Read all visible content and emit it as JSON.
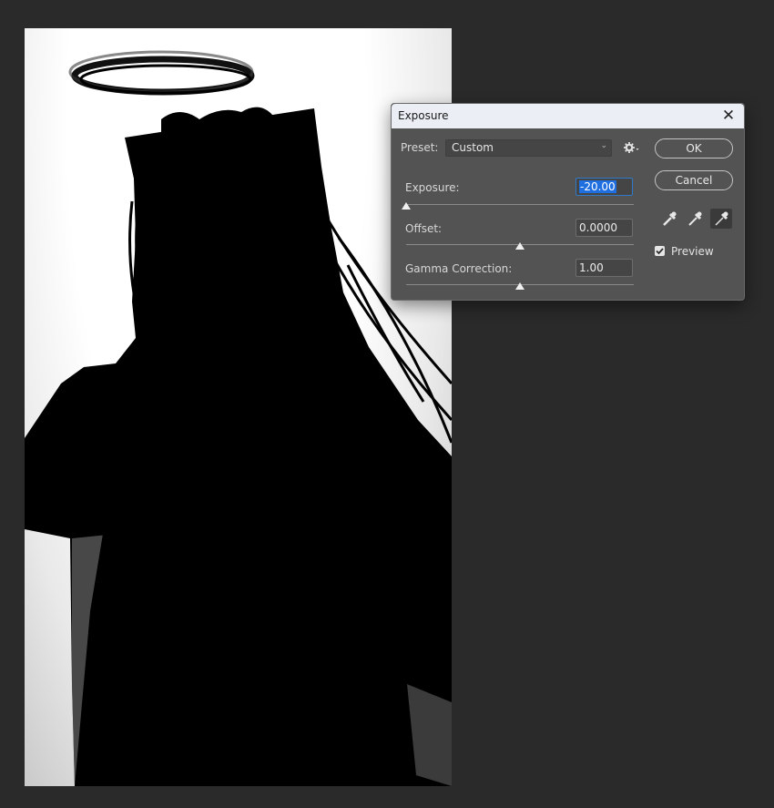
{
  "document": {
    "artwork": "black silhouette of a long-haired figure with a halo on a white-to-gray gradient background"
  },
  "dialog": {
    "title": "Exposure",
    "close_icon": "close-icon",
    "preset": {
      "label": "Preset:",
      "value": "Custom",
      "menu_icon": "gear-icon"
    },
    "sliders": [
      {
        "label": "Exposure:",
        "value": "-20.00",
        "min": -20,
        "max": 20,
        "current": -20
      },
      {
        "label": "Offset:",
        "value": "0.0000",
        "min": -0.5,
        "max": 0.5,
        "current": 0.0
      },
      {
        "label": "Gamma Correction:",
        "value": "1.00",
        "min": 0.01,
        "max": 9.99,
        "current": 1.0
      }
    ],
    "buttons": {
      "ok": "OK",
      "cancel": "Cancel"
    },
    "eyedroppers": [
      "black-point-eyedropper-icon",
      "gray-point-eyedropper-icon",
      "white-point-eyedropper-icon"
    ],
    "preview": {
      "label": "Preview",
      "checked": true
    }
  },
  "colors": {
    "app_background": "#2a2a2a",
    "dialog_background": "#535353",
    "titlebar": "#ebeef5",
    "selection": "#1f6fe0"
  }
}
